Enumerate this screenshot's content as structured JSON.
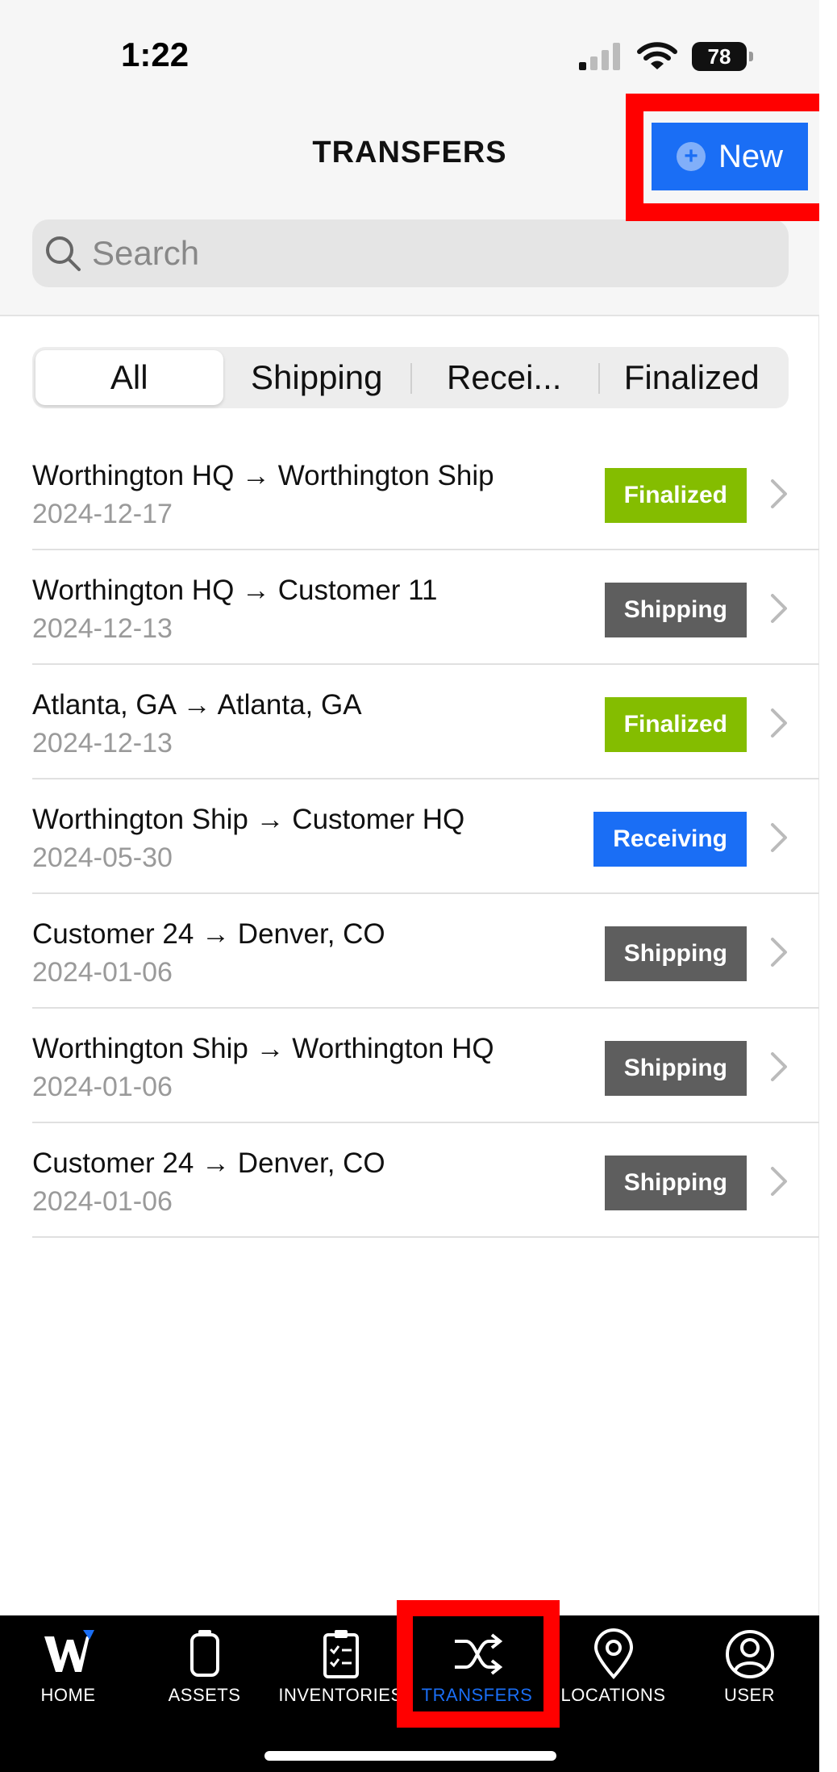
{
  "status_bar": {
    "time": "1:22",
    "battery": "78"
  },
  "header": {
    "title": "TRANSFERS",
    "new_button_label": "New"
  },
  "search": {
    "placeholder": "Search"
  },
  "filters": {
    "items": [
      "All",
      "Shipping",
      "Recei...",
      "Finalized"
    ],
    "selected": "All"
  },
  "transfers": [
    {
      "route": "Worthington HQ → Worthington Ship",
      "date": "2024-12-17",
      "status": "Finalized"
    },
    {
      "route": "Worthington HQ → Customer 11",
      "date": "2024-12-13",
      "status": "Shipping"
    },
    {
      "route": "Atlanta, GA → Atlanta, GA",
      "date": "2024-12-13",
      "status": "Finalized"
    },
    {
      "route": "Worthington Ship → Customer HQ",
      "date": "2024-05-30",
      "status": "Receiving"
    },
    {
      "route": "Customer 24 → Denver, CO",
      "date": "2024-01-06",
      "status": "Shipping"
    },
    {
      "route": "Worthington Ship → Worthington HQ",
      "date": "2024-01-06",
      "status": "Shipping"
    },
    {
      "route": "Customer 24 → Denver, CO",
      "date": "2024-01-06",
      "status": "Shipping"
    }
  ],
  "status_colors": {
    "Finalized": "#84bd00",
    "Shipping": "#5e5e5e",
    "Receiving": "#1a6ef5"
  },
  "tabbar": {
    "items": [
      {
        "label": "HOME",
        "icon": "brand-logo-icon"
      },
      {
        "label": "ASSETS",
        "icon": "asset-tag-icon"
      },
      {
        "label": "INVENTORIES",
        "icon": "clipboard-checklist-icon"
      },
      {
        "label": "TRANSFERS",
        "icon": "shuffle-arrows-icon"
      },
      {
        "label": "LOCATIONS",
        "icon": "map-pin-icon"
      },
      {
        "label": "USER",
        "icon": "user-circle-icon"
      }
    ],
    "active": "TRANSFERS"
  },
  "accent_color": "#1a6ef5",
  "highlight_color": "#ff0000"
}
